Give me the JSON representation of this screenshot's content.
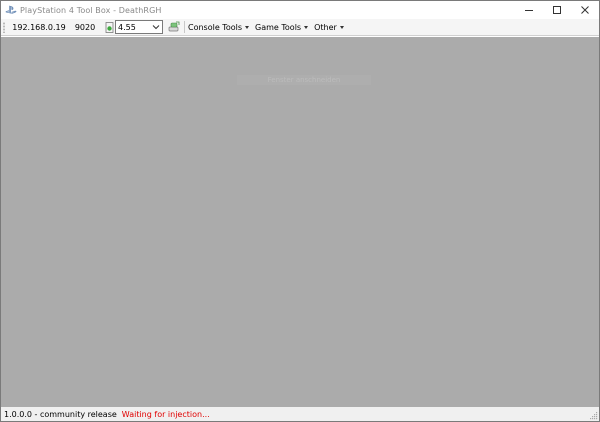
{
  "window": {
    "title": "PlayStation 4 Tool Box - DeathRGH",
    "icon": "playstation-logo-icon",
    "controls": [
      "minimize-icon",
      "maximize-icon",
      "close-icon"
    ]
  },
  "toolbar": {
    "ip": "192.168.0.19",
    "port": "9020",
    "firmware": "4.55",
    "menus": [
      "Console Tools",
      "Game Tools",
      "Other"
    ]
  },
  "main": {
    "faint_label": "Fenster anschneiden"
  },
  "statusbar": {
    "version": "1.0.0.0 - community release",
    "status": "Waiting for injection...",
    "status_color": "#e00000"
  }
}
